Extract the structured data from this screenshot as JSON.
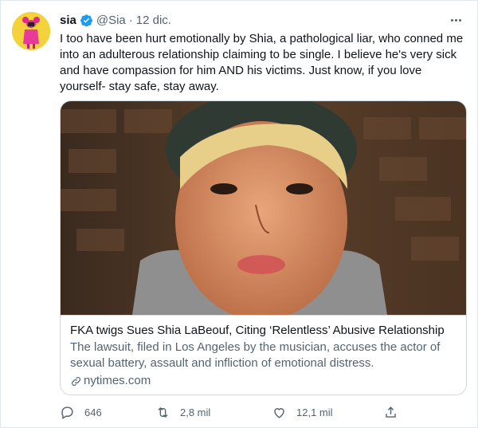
{
  "tweet": {
    "author_name": "sia",
    "author_handle": "@Sia",
    "separator": "·",
    "date": "12 dic.",
    "text": "I too have been hurt emotionally by Shia, a pathological liar, who conned me into an adulterous relationship claiming to be single. I believe he's very sick and have compassion for him AND his victims. Just know, if you love yourself- stay safe, stay away.",
    "verified": true
  },
  "card": {
    "title": "FKA twigs Sues Shia LaBeouf, Citing ‘Relentless’ Abusive Relationship",
    "description": "The lawsuit, filed in Los Angeles by the musician, accuses the actor of sexual battery, assault and infliction of emotional distress.",
    "domain": "nytimes.com"
  },
  "actions": {
    "replies": "646",
    "retweets": "2,8 mil",
    "likes": "12,1 mil"
  },
  "icons": {
    "more": "more-horizontal-icon",
    "verified": "verified-badge-icon",
    "reply": "reply-icon",
    "retweet": "retweet-icon",
    "like": "heart-icon",
    "share": "share-icon",
    "link": "link-icon"
  },
  "colors": {
    "text": "#0f1419",
    "secondary": "#536471",
    "verified": "#1d9bf0",
    "border": "#cfd9de",
    "avatar_bg": "#f3d23a"
  }
}
